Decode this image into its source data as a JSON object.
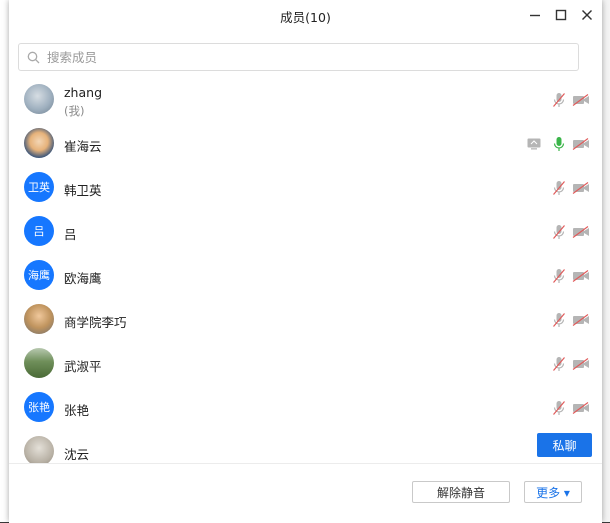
{
  "window": {
    "title": "成员(10)",
    "minimize_icon": "minimize-icon",
    "maximize_icon": "maximize-icon",
    "close_icon": "close-icon"
  },
  "search": {
    "placeholder": "搜索成员",
    "value": "",
    "icon": "search-icon"
  },
  "members": [
    {
      "name": "zhang",
      "sub": "(我)",
      "avatar": "photo",
      "share": false,
      "mic": "muted",
      "cam": "off"
    },
    {
      "name": "崔海云",
      "sub": "",
      "avatar": "photo",
      "share": true,
      "mic": "on",
      "cam": "off"
    },
    {
      "name": "韩卫英",
      "sub": "",
      "avatar": "text",
      "avatar_text": "卫英",
      "share": false,
      "mic": "muted",
      "cam": "off"
    },
    {
      "name": "吕",
      "sub": "",
      "avatar": "text",
      "avatar_text": "吕",
      "share": false,
      "mic": "muted",
      "cam": "off"
    },
    {
      "name": "欧海鹰",
      "sub": "",
      "avatar": "text",
      "avatar_text": "海鹰",
      "share": false,
      "mic": "muted",
      "cam": "off"
    },
    {
      "name": "商学院李巧",
      "sub": "",
      "avatar": "photo",
      "share": false,
      "mic": "muted",
      "cam": "off"
    },
    {
      "name": "武淑平",
      "sub": "",
      "avatar": "photo",
      "share": false,
      "mic": "muted",
      "cam": "off"
    },
    {
      "name": "张艳",
      "sub": "",
      "avatar": "text",
      "avatar_text": "张艳",
      "share": false,
      "mic": "muted",
      "cam": "off"
    },
    {
      "name": "沈云",
      "sub": "",
      "avatar": "photo",
      "share": false,
      "mic": "",
      "cam": "",
      "hover_button": "私聊"
    }
  ],
  "footer": {
    "unmute_all_label": "解除静音",
    "more_label": "更多 ▾"
  },
  "colors": {
    "accent": "#1a73e8",
    "avatar_blue": "#1677ff",
    "mic_on": "#3bb54a",
    "muted_red": "#e05a5a",
    "icon_gray": "#b5b5b5"
  }
}
